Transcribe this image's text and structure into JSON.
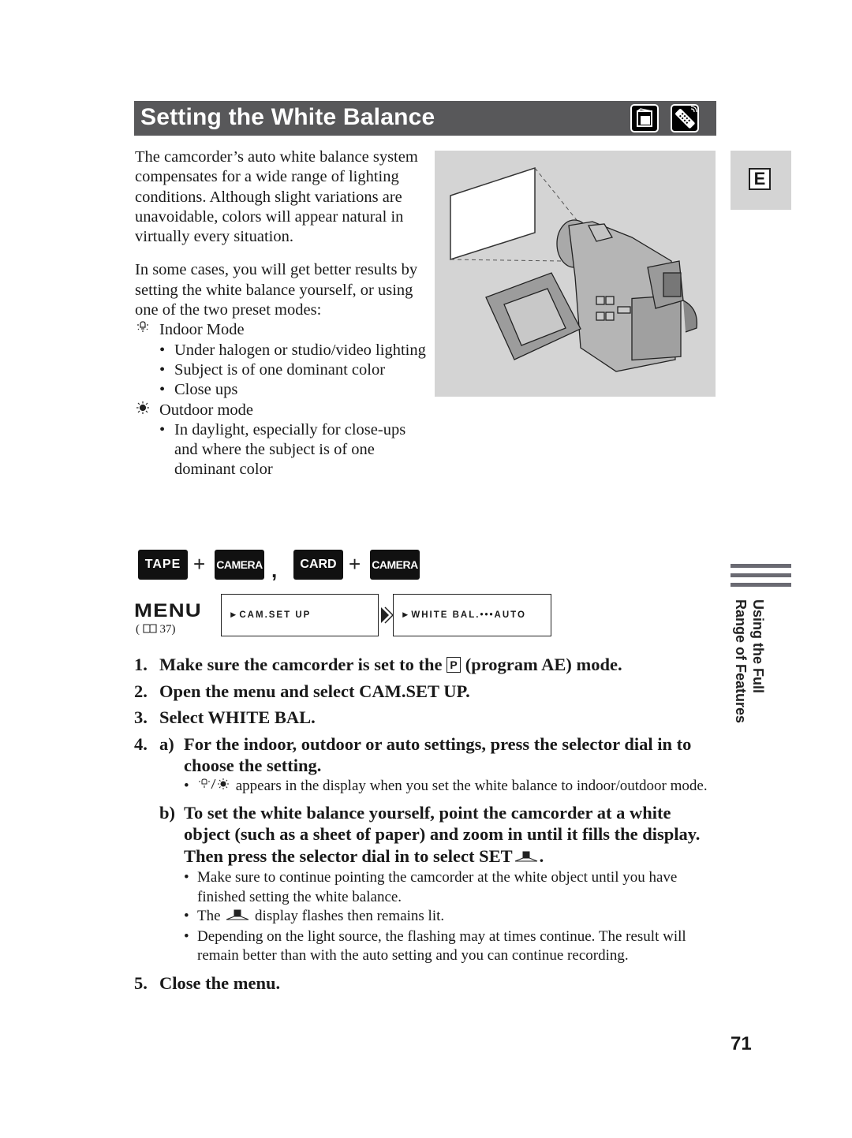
{
  "header": {
    "title": "Setting the White Balance",
    "icons": [
      "camera-mode-icon",
      "remote-control-icon"
    ]
  },
  "intro": {
    "paragraph1": "The camcorder’s auto white balance system compensates for a wide range of lighting conditions. Although slight variations are unavoidable, colors will appear natural in virtually every situation.",
    "paragraph2": "In some cases, you will get better results by setting the white balance yourself, or using one of the two preset modes:",
    "modes": [
      {
        "icon": "indoor-bulb-icon",
        "label": "Indoor Mode",
        "bullets": [
          "Under halogen or studio/video lighting",
          "Subject is of one dominant color",
          "Close ups"
        ]
      },
      {
        "icon": "outdoor-sun-icon",
        "label": "Outdoor mode",
        "bullets": [
          "In daylight, especially for close-ups and where the subject is of one dominant color"
        ]
      }
    ]
  },
  "illustration": {
    "description": "camcorder-pointed-at-white-sheet"
  },
  "side_tab": {
    "language_letter": "E",
    "section_line1": "Using the Full",
    "section_line2": "Range of Features"
  },
  "modes_required": {
    "combo1": [
      "TAPE",
      "CAMERA"
    ],
    "combo2": [
      "CARD",
      "CAMERA"
    ],
    "plus": "+",
    "separator": ","
  },
  "menu": {
    "label": "MENU",
    "page_ref": "(   37)",
    "page_ref_num": "37",
    "box1": "►CAM.SET UP",
    "box2": "►WHITE BAL.•••AUTO"
  },
  "steps": [
    {
      "num": "1.",
      "pre": "Make sure the camcorder is set to the ",
      "badge": "P",
      "post": " (program AE) mode."
    },
    {
      "num": "2.",
      "text": "Open the menu and select CAM.SET UP."
    },
    {
      "num": "3.",
      "text": "Select WHITE BAL."
    },
    {
      "num": "4.",
      "sub_a": {
        "label": "a)",
        "text": "For the indoor, outdoor or auto settings, press the selector dial in to choose the setting.",
        "note_post": " appears in the display when you set the white balance to indoor/outdoor mode."
      },
      "sub_b": {
        "label": "b)",
        "text": "To set the white balance yourself, point the camcorder at a white object (such as a sheet of paper) and zoom in until it fills the display. Then press the selector dial in to select SET",
        "text_end": ".",
        "notes": [
          "Make sure to continue pointing the camcorder at the white object until you have finished setting the white balance.",
          {
            "pre": "The ",
            "post": " display flashes then remains lit."
          },
          "Depending on the light source, the flashing may at times continue. The result will remain better than with the auto setting and you can continue recording."
        ]
      }
    },
    {
      "num": "5.",
      "text": "Close the menu."
    }
  ],
  "page_number": "71",
  "colors": {
    "title_bar": "#58585a",
    "panel_gray": "#d4d4d4",
    "button_black": "#111111"
  }
}
